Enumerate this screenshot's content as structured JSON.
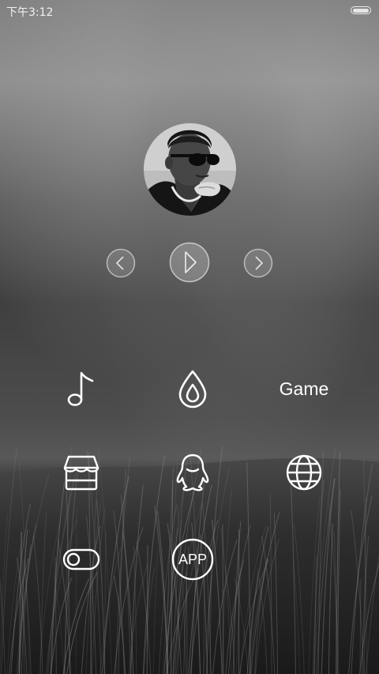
{
  "status_bar": {
    "time": "下午3:12",
    "battery_level": 1.0
  },
  "player": {
    "avatar_icon": "avatar-portrait",
    "prev_icon": "chevron-left-icon",
    "play_icon": "play-icon",
    "next_icon": "chevron-right-icon"
  },
  "apps": [
    {
      "icon": "music-note-icon"
    },
    {
      "icon": "water-drop-icon"
    },
    {
      "label": "Game"
    },
    {
      "icon": "store-icon"
    },
    {
      "icon": "qq-penguin-icon"
    },
    {
      "icon": "globe-icon"
    },
    {
      "icon": "toggle-switch-icon"
    },
    {
      "label": "APP"
    }
  ],
  "colors": {
    "foreground": "#ffffff",
    "sky": "#6e6e6e",
    "grass": "#2e2e2e"
  }
}
